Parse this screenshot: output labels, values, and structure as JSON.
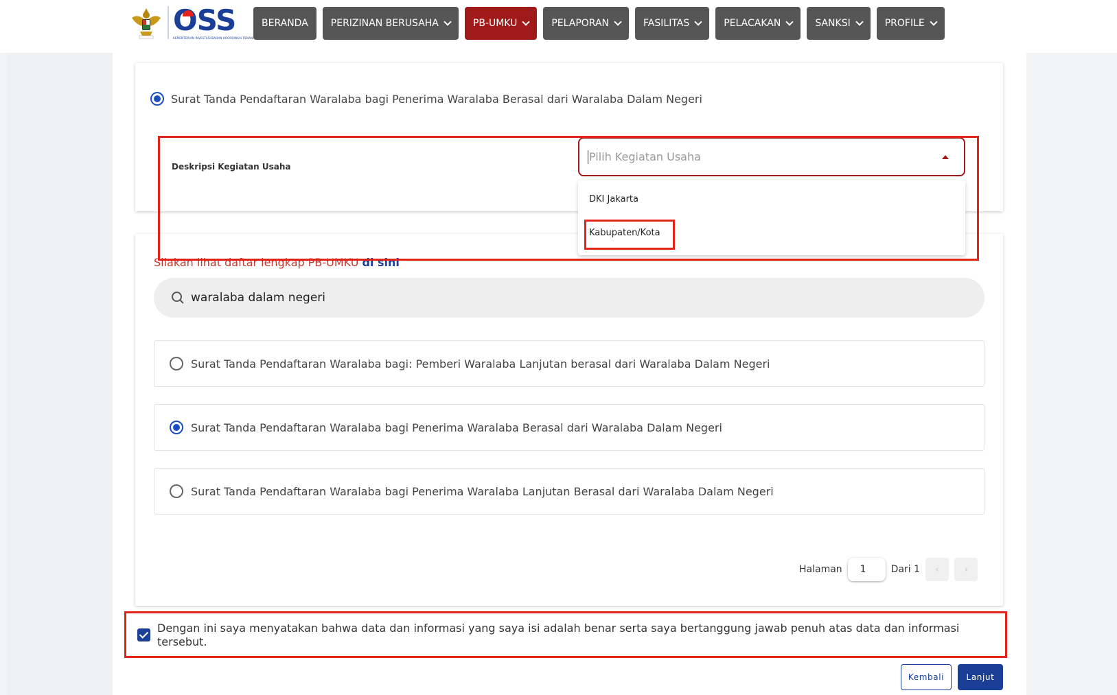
{
  "header": {
    "logo_text": "OSS",
    "logo_subtitle": "KEMENTERIAN INVESTASI/BADAN KOORDINASI PENANAMAN MODAL"
  },
  "nav": {
    "beranda": "BERANDA",
    "perizinan": "PERIZINAN BERUSAHA",
    "pbumku": "PB-UMKU",
    "pelaporan": "PELAPORAN",
    "fasilitas": "FASILITAS",
    "pelacakan": "PELACAKAN",
    "sanksi": "SANKSI",
    "profile": "PROFILE"
  },
  "selected": {
    "label": "Surat Tanda Pendaftaran Waralaba bagi Penerima Waralaba Berasal dari Waralaba Dalam Negeri"
  },
  "form": {
    "desc_label": "Deskripsi Kegiatan Usaha",
    "select_placeholder": "Pilih Kegiatan Usaha",
    "dropdown_options": [
      "DKI Jakarta",
      "Kabupaten/Kota"
    ]
  },
  "info": {
    "text": "Silakan lihat daftar lengkap PB-UMKU ",
    "link": "di sini"
  },
  "search": {
    "value": "waralaba dalam negeri"
  },
  "options": [
    "Surat Tanda Pendaftaran Waralaba bagi: Pemberi Waralaba Lanjutan berasal dari Waralaba Dalam Negeri",
    "Surat Tanda Pendaftaran Waralaba bagi Penerima Waralaba Berasal dari Waralaba Dalam Negeri",
    "Surat Tanda Pendaftaran Waralaba bagi Penerima Waralaba Lanjutan Berasal dari Waralaba Dalam Negeri"
  ],
  "pager": {
    "label": "Halaman",
    "current": "1",
    "total_label": "Dari 1",
    "prev": "‹",
    "next": "›"
  },
  "consent": {
    "text": "Dengan ini saya menyatakan bahwa data dan informasi yang saya isi adalah benar serta saya bertanggung jawab penuh atas data dan informasi tersebut."
  },
  "buttons": {
    "back": "Kembali",
    "next": "Lanjut"
  },
  "colors": {
    "accent_red": "#a11a1a",
    "brand_blue": "#1b3f97",
    "highlight_red": "#e3231a"
  }
}
